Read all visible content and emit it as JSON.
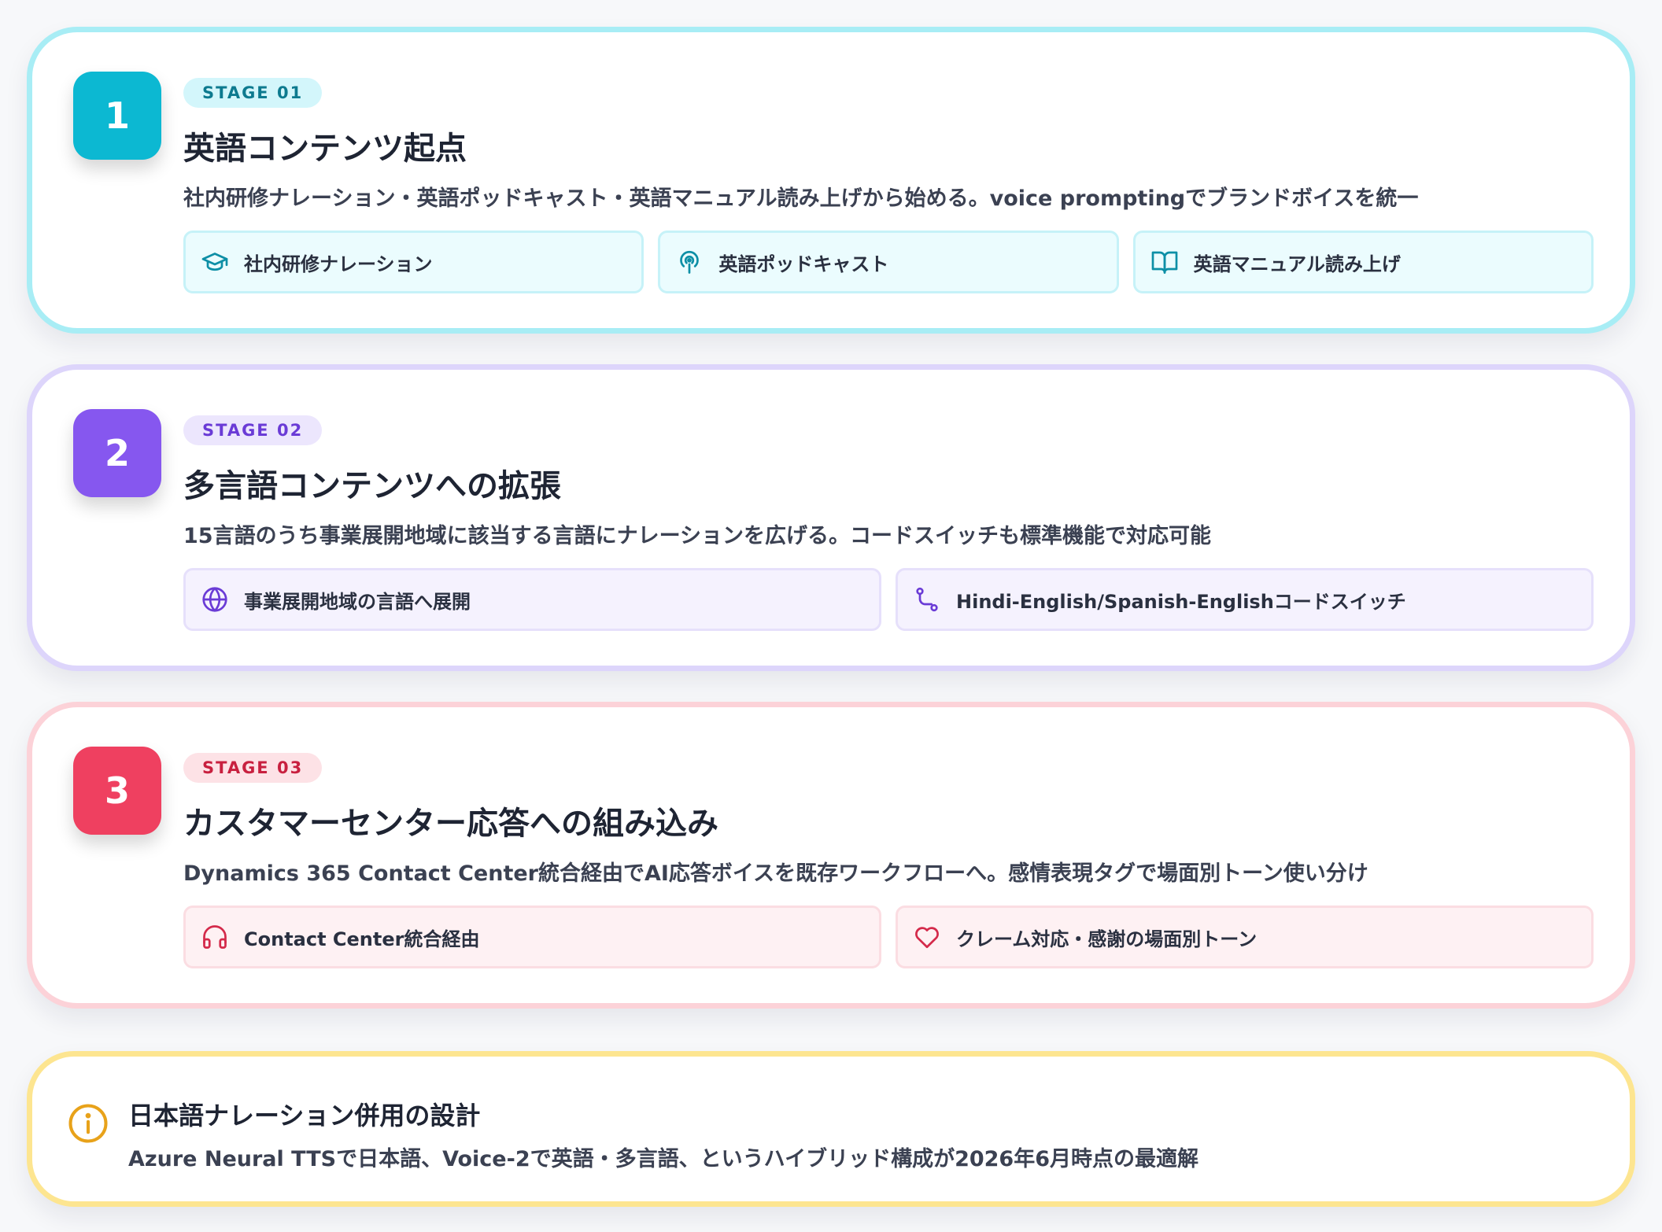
{
  "colors": {
    "stage1_accent": "#0cb8d2",
    "stage2_accent": "#8657ef",
    "stage3_accent": "#ef4060",
    "note_accent": "#e8a21a"
  },
  "stages": [
    {
      "number": "1",
      "badge": "STAGE 01",
      "title": "英語コンテンツ起点",
      "description": "社内研修ナレーション・英語ポッドキャスト・英語マニュアル読み上げから始める。voice promptingでブランドボイスを統一",
      "chips": [
        {
          "icon": "graduation-cap-icon",
          "label": "社内研修ナレーション"
        },
        {
          "icon": "podcast-icon",
          "label": "英語ポッドキャスト"
        },
        {
          "icon": "book-open-icon",
          "label": "英語マニュアル読み上げ"
        }
      ]
    },
    {
      "number": "2",
      "badge": "STAGE 02",
      "title": "多言語コンテンツへの拡張",
      "description": "15言語のうち事業展開地域に該当する言語にナレーションを広げる。コードスイッチも標準機能で対応可能",
      "chips": [
        {
          "icon": "globe-icon",
          "label": "事業展開地域の言語へ展開"
        },
        {
          "icon": "route-icon",
          "label": "Hindi-English/Spanish-Englishコードスイッチ"
        }
      ]
    },
    {
      "number": "3",
      "badge": "STAGE 03",
      "title": "カスタマーセンター応答への組み込み",
      "description": "Dynamics 365 Contact Center統合経由でAI応答ボイスを既存ワークフローへ。感情表現タグで場面別トーン使い分け",
      "chips": [
        {
          "icon": "headphones-icon",
          "label": "Contact Center統合経由"
        },
        {
          "icon": "heart-icon",
          "label": "クレーム対応・感謝の場面別トーン"
        }
      ]
    }
  ],
  "note": {
    "icon": "info-icon",
    "title": "日本語ナレーション併用の設計",
    "text": "Azure Neural TTSで日本語、Voice-2で英語・多言語、というハイブリッド構成が2026年6月時点の最適解"
  }
}
